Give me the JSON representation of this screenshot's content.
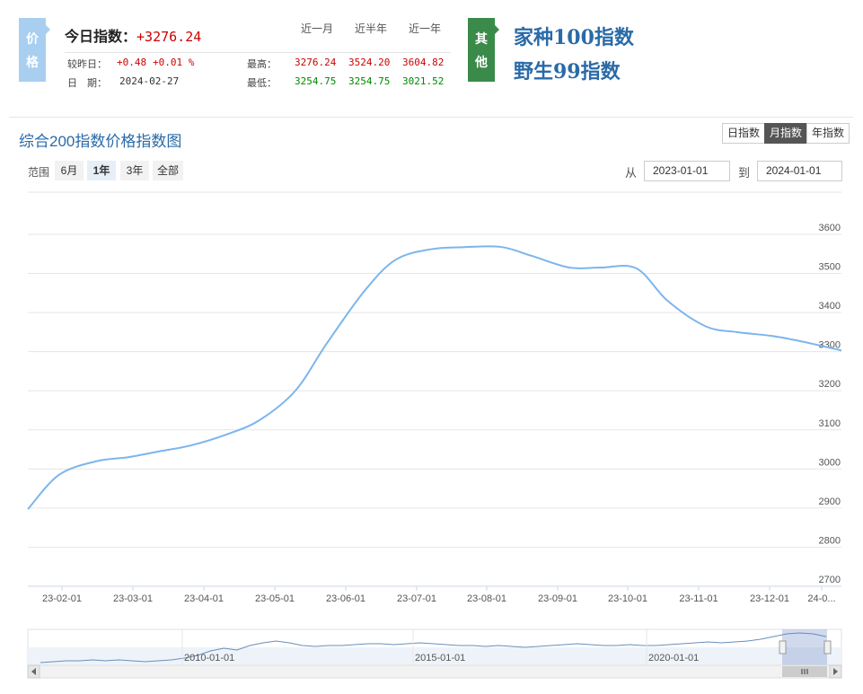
{
  "price_panel": {
    "tag_chars": [
      "价",
      "格"
    ],
    "today_label": "今日指数：",
    "today_value": "+3276.24",
    "col_headers": [
      "近一月",
      "近半年",
      "近一年"
    ],
    "change_label": "较昨日：",
    "change_abs": "+0.48",
    "change_pct": "+0.01 %",
    "date_label": "日　期：",
    "date_value": "2024-02-27",
    "high_label": "最高：",
    "low_label": "最低：",
    "highs": [
      "3276.24",
      "3524.20",
      "3604.82"
    ],
    "lows": [
      "3254.75",
      "3254.75",
      "3021.52"
    ]
  },
  "other_panel": {
    "tag_chars": [
      "其",
      "他"
    ],
    "links": [
      "家种100指数",
      "野生99指数"
    ]
  },
  "chart_header": {
    "title": "综合200指数价格指数图",
    "toggles": [
      "日指数",
      "月指数",
      "年指数"
    ],
    "active_toggle": "月指数",
    "range_label": "范围",
    "range_buttons": [
      "6月",
      "1年",
      "3年",
      "全部"
    ],
    "active_range": "1年",
    "from_label": "从",
    "from_date": "2023-01-01",
    "to_label": "到",
    "to_date": "2024-01-01"
  },
  "colors": {
    "line": "#7cb5ec",
    "up": "#cc0000",
    "down": "#008800",
    "brand": "#2a6aa8"
  },
  "chart_data": {
    "type": "line",
    "title": "综合200指数价格指数图",
    "xlabel": "",
    "ylabel": "",
    "ylim": [
      2700,
      3650
    ],
    "yticks": [
      2700,
      2800,
      2900,
      3000,
      3100,
      3200,
      3300,
      3400,
      3500,
      3600
    ],
    "xticks": [
      "23-02-01",
      "23-03-01",
      "23-04-01",
      "23-05-01",
      "23-06-01",
      "23-07-01",
      "23-08-01",
      "23-09-01",
      "23-10-01",
      "23-11-01",
      "23-12-01",
      "24-0..."
    ],
    "grid": true,
    "series": [
      {
        "values": [
          {
            "x": "2023-01-01",
            "y": 2897
          },
          {
            "x": "2023-01-15",
            "y": 2985
          },
          {
            "x": "2023-02-01",
            "y": 3020
          },
          {
            "x": "2023-02-15",
            "y": 3030
          },
          {
            "x": "2023-03-01",
            "y": 3045
          },
          {
            "x": "2023-03-15",
            "y": 3060
          },
          {
            "x": "2023-04-01",
            "y": 3090
          },
          {
            "x": "2023-04-15",
            "y": 3125
          },
          {
            "x": "2023-05-01",
            "y": 3200
          },
          {
            "x": "2023-05-15",
            "y": 3320
          },
          {
            "x": "2023-06-01",
            "y": 3455
          },
          {
            "x": "2023-06-15",
            "y": 3535
          },
          {
            "x": "2023-07-01",
            "y": 3562
          },
          {
            "x": "2023-07-15",
            "y": 3567
          },
          {
            "x": "2023-08-01",
            "y": 3568
          },
          {
            "x": "2023-08-15",
            "y": 3545
          },
          {
            "x": "2023-09-01",
            "y": 3515
          },
          {
            "x": "2023-09-15",
            "y": 3515
          },
          {
            "x": "2023-10-01",
            "y": 3513
          },
          {
            "x": "2023-10-15",
            "y": 3430
          },
          {
            "x": "2023-11-01",
            "y": 3365
          },
          {
            "x": "2023-11-15",
            "y": 3350
          },
          {
            "x": "2023-12-01",
            "y": 3340
          },
          {
            "x": "2023-12-15",
            "y": 3325
          },
          {
            "x": "2024-01-01",
            "y": 3303
          }
        ]
      }
    ],
    "navigator": {
      "labels": [
        "2010-01-01",
        "2015-01-01",
        "2020-01-01"
      ]
    }
  }
}
